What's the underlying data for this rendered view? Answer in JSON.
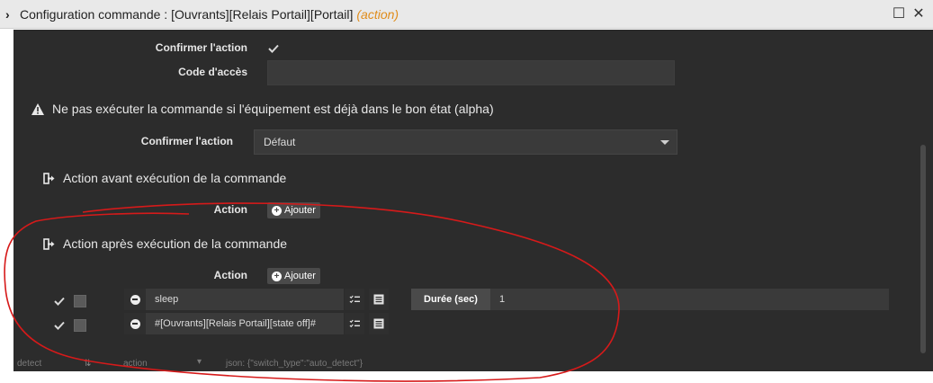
{
  "window": {
    "title": "Configuration commande : [Ouvrants][Relais Portail][Portail]",
    "subtitle": "(action)"
  },
  "form": {
    "confirm_label": "Confirmer l'action",
    "access_code_label": "Code d'accès",
    "access_code_value": ""
  },
  "warning": {
    "text": "Ne pas exécuter la commande si l'équipement est déjà dans le bon état (alpha)",
    "confirm_label": "Confirmer l'action",
    "select_value": "Défaut"
  },
  "before": {
    "title": "Action avant exécution de la commande",
    "action_label": "Action",
    "add_label": "Ajouter"
  },
  "after": {
    "title": "Action après exécution de la commande",
    "action_label": "Action",
    "add_label": "Ajouter",
    "rows": [
      {
        "command": "sleep",
        "option_label": "Durée (sec)",
        "option_value": "1"
      },
      {
        "command": "#[Ouvrants][Relais Portail][state off]#"
      }
    ]
  },
  "background_row": {
    "col1": "detect",
    "col2": "action",
    "col3": "json: {\"switch_type\":\"auto_detect\"}"
  },
  "colors": {
    "panel_bg": "#2c2c2c",
    "accent_orange": "#e08c1a",
    "annotation_red": "#d61a1a"
  }
}
